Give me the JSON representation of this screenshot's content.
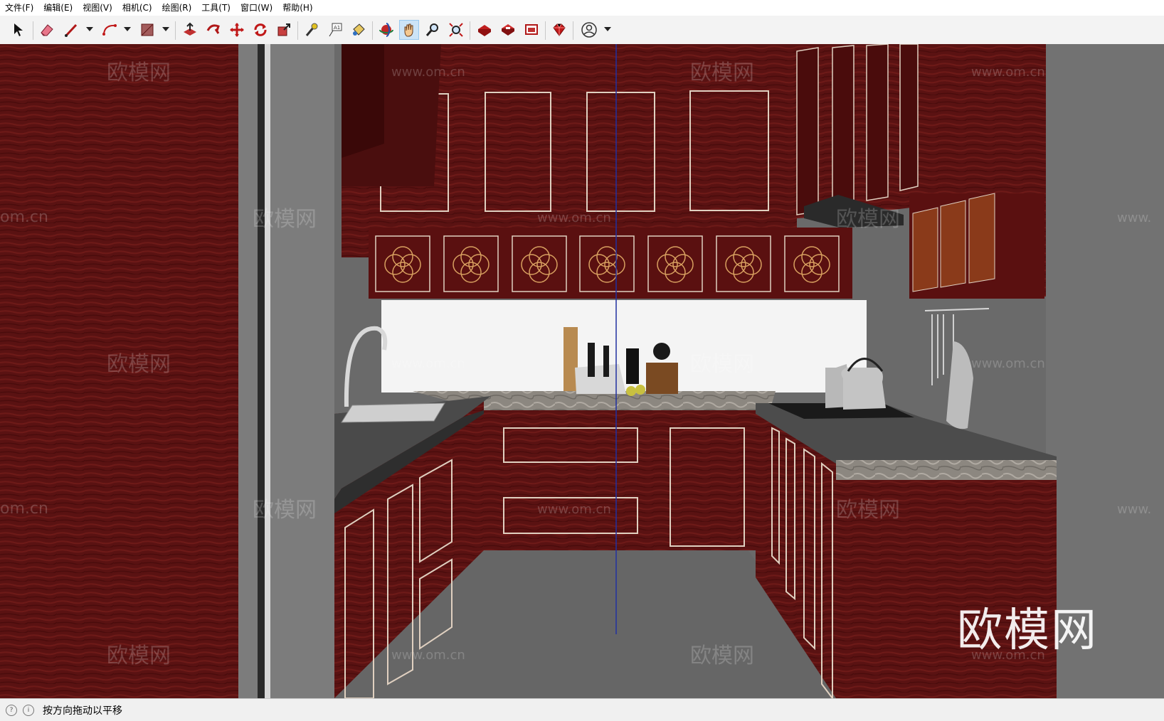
{
  "menu": [
    "文件(F)",
    "编辑(E)",
    "视图(V)",
    "相机(C)",
    "绘图(R)",
    "工具(T)",
    "窗口(W)",
    "帮助(H)"
  ],
  "toolbar": {
    "tools": [
      "select-icon",
      "eraser-icon",
      "line-icon",
      "arc-icon",
      "rectangle-icon",
      "push-pull-icon",
      "follow-me-icon",
      "move-icon",
      "rotate-icon",
      "scale-icon",
      "tape-measure-icon",
      "text-icon",
      "paint-bucket-icon",
      "orbit-icon",
      "pan-icon",
      "zoom-icon",
      "zoom-extents-icon",
      "warehouse-icon",
      "extension-warehouse-icon",
      "layout-icon",
      "ruby-icon",
      "account-icon"
    ],
    "active_tool": "pan-icon"
  },
  "viewport": {
    "watermark_brand": "欧模网",
    "watermark_url": "www.om.cn",
    "watermark_partial_left": "om.cn",
    "watermark_partial_right": "www."
  },
  "status": {
    "text": "按方向拖动以平移"
  },
  "colors": {
    "wood": "#5a1212",
    "wood_dark": "#3e0a0a",
    "wall": "#707070",
    "counter": "#4a4a4a",
    "toolbar_active": "#cce4f7"
  }
}
